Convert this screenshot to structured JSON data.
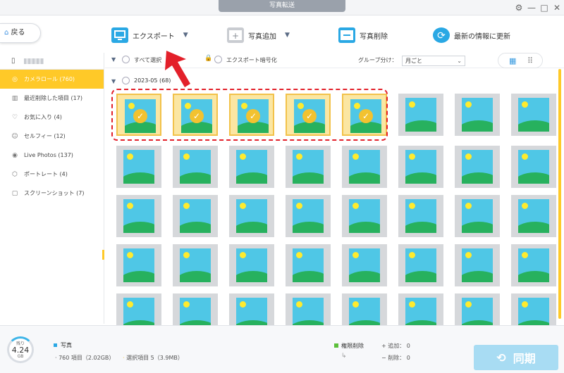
{
  "window": {
    "title": "写真転送"
  },
  "toolbar": {
    "back_label": "戻る",
    "export_label": "エクスポート",
    "add_label": "写真追加",
    "delete_label": "写真削除",
    "refresh_label": "最新の情報に更新"
  },
  "sidebar": {
    "items": [
      {
        "label": "カメラロール (760)",
        "icon": "camera-icon"
      },
      {
        "label": "最近削除した項目 (17)",
        "icon": "trash-icon"
      },
      {
        "label": "お気に入り (4)",
        "icon": "heart-icon"
      },
      {
        "label": "セルフィー (12)",
        "icon": "selfie-icon"
      },
      {
        "label": "Live Photos (137)",
        "icon": "live-photo-icon"
      },
      {
        "label": "ポートレート (4)",
        "icon": "portrait-icon"
      },
      {
        "label": "スクリーンショット (7)",
        "icon": "screenshot-icon"
      }
    ]
  },
  "filterbar": {
    "select_all": "すべて選択",
    "export_encrypt": "エクスポート暗号化",
    "group_label": "グループ分け：",
    "group_value": "月ごと"
  },
  "group": {
    "label": "2023-05",
    "count": "(68)"
  },
  "photos": {
    "selected_count": 5
  },
  "footer": {
    "storage_label": "残り",
    "storage_value": "4.24",
    "storage_unit": "GB",
    "category": "写真",
    "item_count": "760 項目（2.02GB）",
    "selected": "選択項目 5（3.9MB）",
    "permission": "権限削除",
    "added": "追加： 0",
    "deleted": "削除： 0",
    "sync_label": "同期"
  },
  "colors": {
    "accent": "#ffc928",
    "annotation": "#e3202a",
    "sync": "#a8dcf3"
  }
}
